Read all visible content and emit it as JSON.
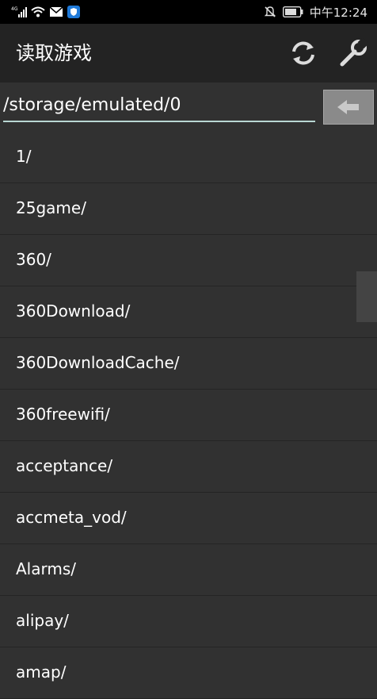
{
  "status_bar": {
    "network": "4G",
    "time": "中午12:24"
  },
  "app_bar": {
    "title": "读取游戏",
    "actions": [
      {
        "icon": "refresh-icon"
      },
      {
        "icon": "wrench-icon"
      }
    ]
  },
  "path_bar": {
    "path": "/storage/emulated/0",
    "back_icon": "arrow-left-icon"
  },
  "files": [
    "1/",
    "25game/",
    "360/",
    "360Download/",
    "360DownloadCache/",
    "360freewifi/",
    "acceptance/",
    "accmeta_vod/",
    "Alarms/",
    "alipay/",
    "amap/"
  ],
  "colors": {
    "background": "#313131",
    "app_bar": "#232323",
    "status_bar": "#000000",
    "divider": "#242424",
    "underline": "#b9d7d3"
  }
}
